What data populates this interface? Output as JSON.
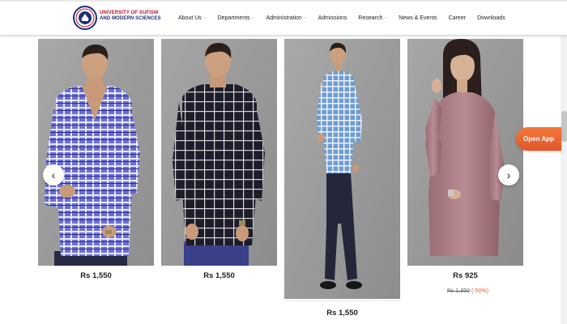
{
  "header": {
    "logo_icon": "university-crest-icon",
    "brand_line1": "UNIVERSITY OF SUFISM",
    "brand_line2": "AND MODERN SCIENCES",
    "nav": [
      {
        "label": "About Us",
        "has_dropdown": true
      },
      {
        "label": "Departments",
        "has_dropdown": true
      },
      {
        "label": "Administration",
        "has_dropdown": true
      },
      {
        "label": "Admissions",
        "has_dropdown": false
      },
      {
        "label": "Research",
        "has_dropdown": true
      },
      {
        "label": "News & Events",
        "has_dropdown": false
      },
      {
        "label": "Career",
        "has_dropdown": false
      },
      {
        "label": "Downloads",
        "has_dropdown": false
      }
    ],
    "dropdown_icon": "chevron-down-icon"
  },
  "products": [
    {
      "price": "Rs 1,550",
      "item": "blue-checked-shirt"
    },
    {
      "price": "Rs 1,550",
      "item": "black-checked-shirt"
    },
    {
      "price": "Rs 1,550",
      "item": "light-blue-checked-shirt"
    },
    {
      "price": "Rs 925",
      "old_price": "Rs 1,850",
      "discount": "(-50%)",
      "item": "mauve-satin-shirt"
    }
  ],
  "carousel": {
    "prev_glyph": "‹",
    "next_glyph": "›",
    "prev_icon": "chevron-left-icon",
    "next_icon": "chevron-right-icon"
  },
  "open_app": {
    "label": "Open App"
  },
  "colors": {
    "brand_red": "#c8102e",
    "brand_blue": "#1d2f78",
    "accent_orange": "#e2552a",
    "discount": "#e25d2b"
  }
}
